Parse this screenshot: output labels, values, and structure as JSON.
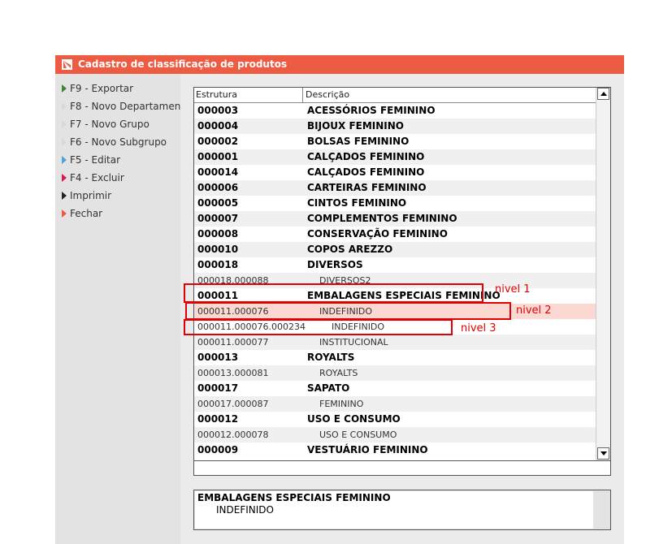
{
  "window": {
    "title": "Cadastro de classificação de produtos",
    "accent": "#ee5b43"
  },
  "sidebar": {
    "items": [
      {
        "label": "F9 - Exportar",
        "icon": "export-arrow-icon",
        "color": "#3c8a2f"
      },
      {
        "label": "F8 - Novo Departamento",
        "icon": "new-department-arrow-icon",
        "color": "#d8d8d8"
      },
      {
        "label": "F7 - Novo Grupo",
        "icon": "new-group-arrow-icon",
        "color": "#d8d8d8"
      },
      {
        "label": "F6 - Novo Subgrupo",
        "icon": "new-subgroup-arrow-icon",
        "color": "#d8d8d8"
      },
      {
        "label": "F5 - Editar",
        "icon": "edit-arrow-icon",
        "color": "#4aa3df"
      },
      {
        "label": "F4 - Excluir",
        "icon": "delete-arrow-icon",
        "color": "#d81b4f"
      },
      {
        "label": "Imprimir",
        "icon": "print-arrow-icon",
        "color": "#222222"
      },
      {
        "label": "Fechar",
        "icon": "close-arrow-icon",
        "color": "#ee5b43"
      }
    ]
  },
  "grid": {
    "columns": [
      "Estrutura",
      "Descrição"
    ],
    "rows": [
      {
        "code": "000003",
        "desc": "ACESSÓRIOS FEMININO",
        "level": 1
      },
      {
        "code": "000004",
        "desc": "BIJOUX FEMININO",
        "level": 1
      },
      {
        "code": "000002",
        "desc": "BOLSAS FEMININO",
        "level": 1
      },
      {
        "code": "000001",
        "desc": "CALÇADOS FEMININO",
        "level": 1
      },
      {
        "code": "000014",
        "desc": "CALÇADOS FEMININO",
        "level": 1
      },
      {
        "code": "000006",
        "desc": "CARTEIRAS FEMININO",
        "level": 1
      },
      {
        "code": "000005",
        "desc": "CINTOS FEMININO",
        "level": 1
      },
      {
        "code": "000007",
        "desc": "COMPLEMENTOS FEMININO",
        "level": 1
      },
      {
        "code": "000008",
        "desc": "CONSERVAÇÃO FEMININO",
        "level": 1
      },
      {
        "code": "000010",
        "desc": "COPOS AREZZO",
        "level": 1
      },
      {
        "code": "000018",
        "desc": "DIVERSOS",
        "level": 1
      },
      {
        "code": "000018.000088",
        "desc": "DIVERSOS2",
        "level": 2
      },
      {
        "code": "000011",
        "desc": "EMBALAGENS ESPECIAIS FEMININO",
        "level": 1
      },
      {
        "code": "000011.000076",
        "desc": "INDEFINIDO",
        "level": 2,
        "selected": true
      },
      {
        "code": "000011.000076.000234",
        "desc": "INDEFINIDO",
        "level": 3
      },
      {
        "code": "000011.000077",
        "desc": "INSTITUCIONAL",
        "level": 2
      },
      {
        "code": "000013",
        "desc": "ROYALTS",
        "level": 1
      },
      {
        "code": "000013.000081",
        "desc": "ROYALTS",
        "level": 2
      },
      {
        "code": "000017",
        "desc": "SAPATO",
        "level": 1
      },
      {
        "code": "000017.000087",
        "desc": "FEMININO",
        "level": 2
      },
      {
        "code": "000012",
        "desc": "USO E CONSUMO",
        "level": 1
      },
      {
        "code": "000012.000078",
        "desc": "USO E CONSUMO",
        "level": 2
      },
      {
        "code": "000009",
        "desc": "VESTUÁRIO FEMININO",
        "level": 1
      }
    ]
  },
  "detail": {
    "line1": "EMBALAGENS ESPECIAIS FEMININO",
    "line2": "INDEFINIDO"
  },
  "annotations": [
    {
      "label": "nivel 1"
    },
    {
      "label": "nivel 2"
    },
    {
      "label": "nivel 3"
    }
  ],
  "annotation_color": "#e30000"
}
